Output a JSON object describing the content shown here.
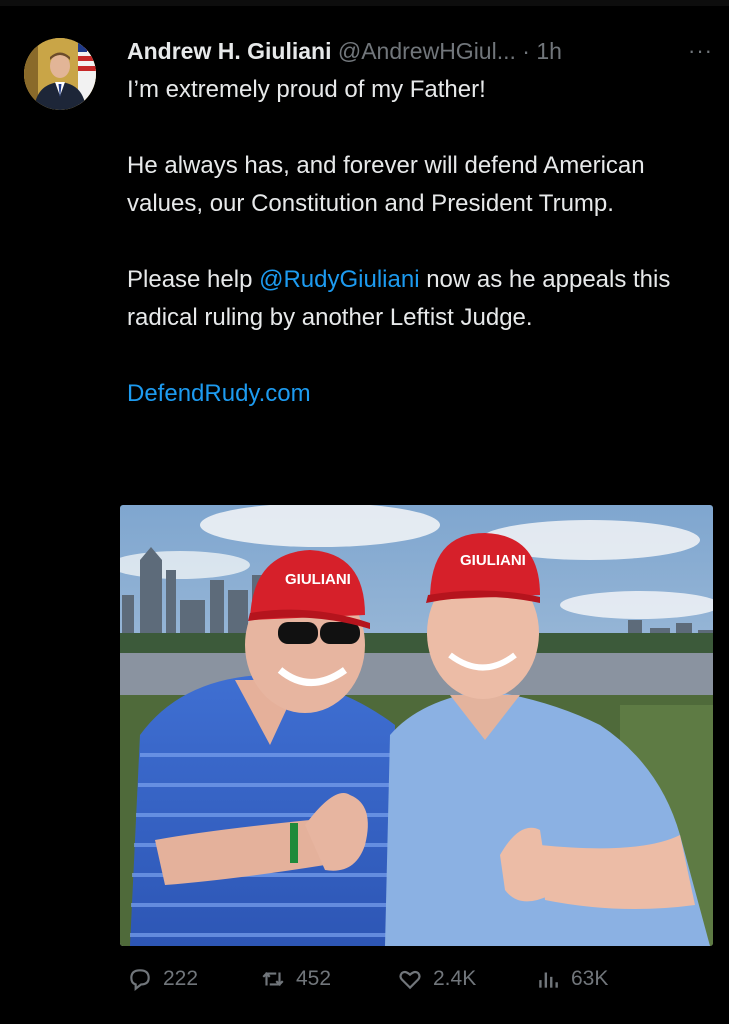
{
  "tweet": {
    "author_name": "Andrew H. Giuliani",
    "author_handle": "@AndrewHGiul...",
    "separator": " · ",
    "time": "1h",
    "more_label": "···",
    "lines": [
      "I’m extremely proud of my Father!",
      "He always has, and forever will defend American values, our Constitution and President Trump."
    ],
    "para3_before": "Please help ",
    "mention": "@RudyGiuliani",
    "para3_after": " now as he appeals this radical ruling by another Leftist Judge.",
    "website": "DefendRudy.com",
    "photo": {
      "left_hat_text": "GIULIANI",
      "right_hat_text": "GIULIANI"
    }
  },
  "actions": {
    "reply_count": "222",
    "retweet_count": "452",
    "like_count": "2.4K",
    "views_count": "63K"
  },
  "colors": {
    "background": "#000000",
    "text": "#e7e9ea",
    "muted": "#71767b",
    "link": "#1d9bf0"
  },
  "icons": [
    "reply-icon",
    "retweet-icon",
    "like-icon",
    "views-icon",
    "more-icon"
  ]
}
